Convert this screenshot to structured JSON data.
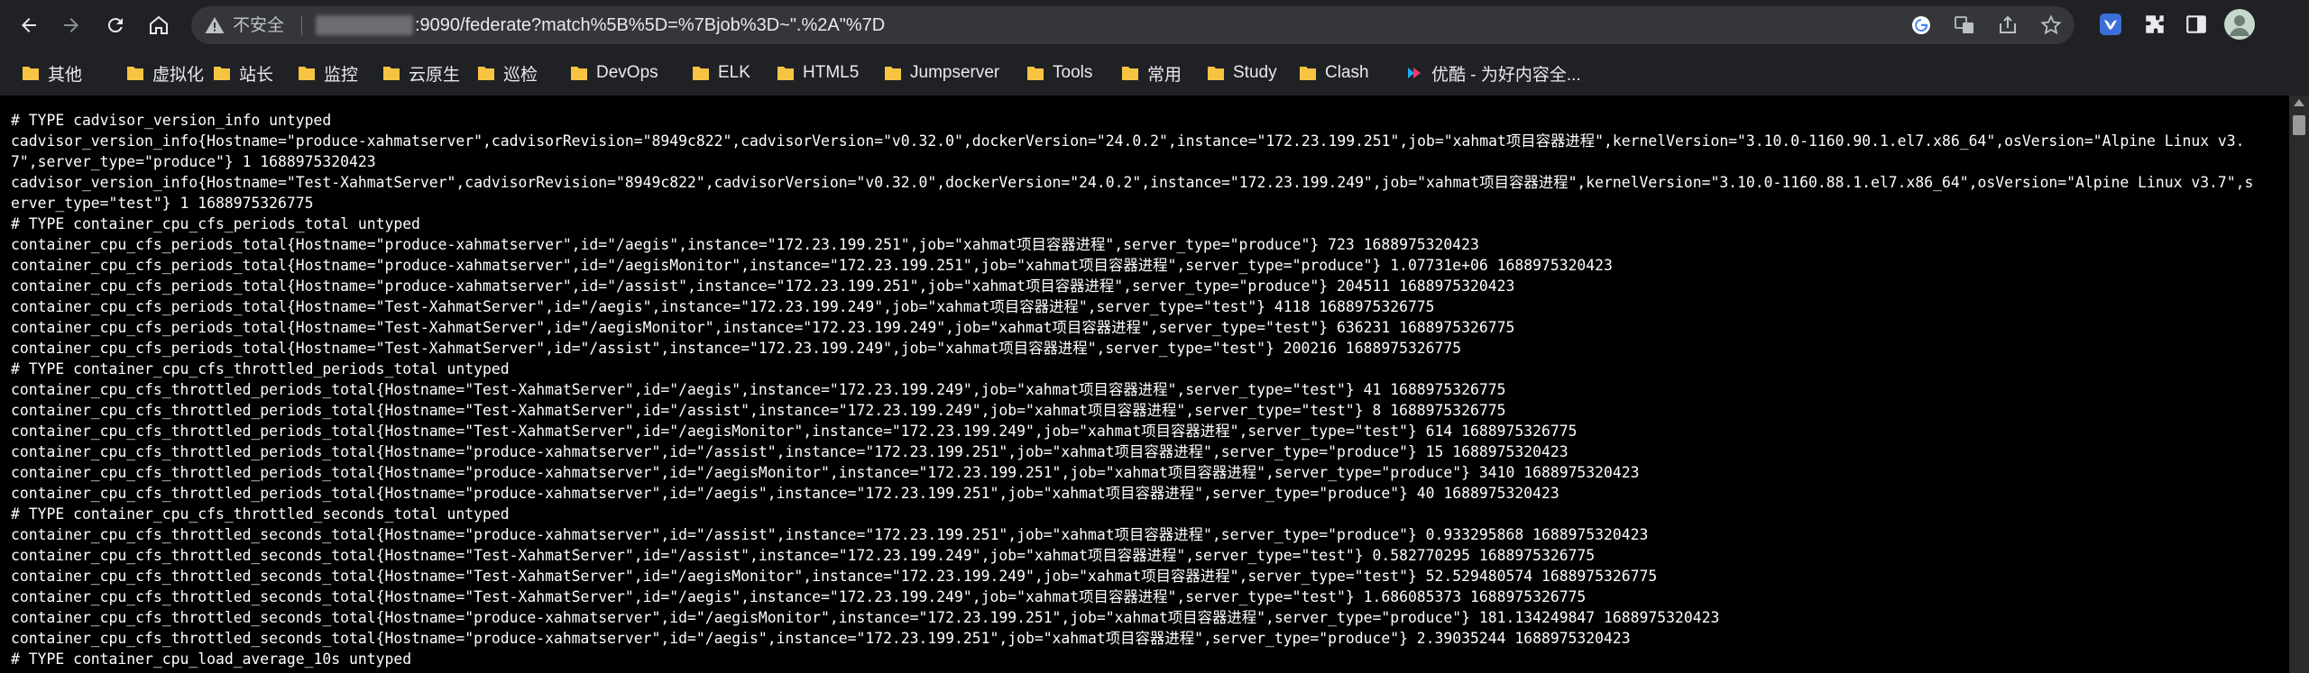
{
  "browser": {
    "security_label": "不安全",
    "url_visible": ":9090/federate?match%5B%5D=%7Bjob%3D~\".%2A\"%7D",
    "icons": [
      "back-arrow-icon",
      "forward-arrow-icon",
      "reload-icon",
      "home-icon",
      "warning-icon",
      "google-icon",
      "translate-icon",
      "share-icon",
      "star-icon",
      "extension-bird-icon",
      "puzzle-icon",
      "sidepanel-icon",
      "avatar"
    ]
  },
  "bookmarks": [
    {
      "label": "其他"
    },
    {
      "label": "虚拟化"
    },
    {
      "label": "站长"
    },
    {
      "label": "监控"
    },
    {
      "label": "云原生"
    },
    {
      "label": "巡检"
    },
    {
      "label": "DevOps"
    },
    {
      "label": "ELK"
    },
    {
      "label": "HTML5"
    },
    {
      "label": "Jumpserver"
    },
    {
      "label": "Tools"
    },
    {
      "label": "常用"
    },
    {
      "label": "Study"
    },
    {
      "label": "Clash"
    },
    {
      "label": "优酷 - 为好内容全..."
    }
  ],
  "colors": {
    "chrome_bg": "#202124",
    "omnibox_bg": "#35363a",
    "folder": "#f6c343",
    "page_bg": "#000000",
    "page_text": "#ffffff"
  },
  "lines": [
    "# TYPE cadvisor_version_info untyped",
    "cadvisor_version_info{Hostname=\"produce-xahmatserver\",cadvisorRevision=\"8949c822\",cadvisorVersion=\"v0.32.0\",dockerVersion=\"24.0.2\",instance=\"172.23.199.251\",job=\"xahmat项目容器进程\",kernelVersion=\"3.10.0-1160.90.1.el7.x86_64\",osVersion=\"Alpine Linux v3.7\",server_type=\"produce\"} 1 1688975320423",
    "cadvisor_version_info{Hostname=\"Test-XahmatServer\",cadvisorRevision=\"8949c822\",cadvisorVersion=\"v0.32.0\",dockerVersion=\"24.0.2\",instance=\"172.23.199.249\",job=\"xahmat项目容器进程\",kernelVersion=\"3.10.0-1160.88.1.el7.x86_64\",osVersion=\"Alpine Linux v3.7\",server_type=\"test\"} 1 1688975326775",
    "# TYPE container_cpu_cfs_periods_total untyped",
    "container_cpu_cfs_periods_total{Hostname=\"produce-xahmatserver\",id=\"/aegis\",instance=\"172.23.199.251\",job=\"xahmat项目容器进程\",server_type=\"produce\"} 723 1688975320423",
    "container_cpu_cfs_periods_total{Hostname=\"produce-xahmatserver\",id=\"/aegisMonitor\",instance=\"172.23.199.251\",job=\"xahmat项目容器进程\",server_type=\"produce\"} 1.07731e+06 1688975320423",
    "container_cpu_cfs_periods_total{Hostname=\"produce-xahmatserver\",id=\"/assist\",instance=\"172.23.199.251\",job=\"xahmat项目容器进程\",server_type=\"produce\"} 204511 1688975320423",
    "container_cpu_cfs_periods_total{Hostname=\"Test-XahmatServer\",id=\"/aegis\",instance=\"172.23.199.249\",job=\"xahmat项目容器进程\",server_type=\"test\"} 4118 1688975326775",
    "container_cpu_cfs_periods_total{Hostname=\"Test-XahmatServer\",id=\"/aegisMonitor\",instance=\"172.23.199.249\",job=\"xahmat项目容器进程\",server_type=\"test\"} 636231 1688975326775",
    "container_cpu_cfs_periods_total{Hostname=\"Test-XahmatServer\",id=\"/assist\",instance=\"172.23.199.249\",job=\"xahmat项目容器进程\",server_type=\"test\"} 200216 1688975326775",
    "# TYPE container_cpu_cfs_throttled_periods_total untyped",
    "container_cpu_cfs_throttled_periods_total{Hostname=\"Test-XahmatServer\",id=\"/aegis\",instance=\"172.23.199.249\",job=\"xahmat项目容器进程\",server_type=\"test\"} 41 1688975326775",
    "container_cpu_cfs_throttled_periods_total{Hostname=\"Test-XahmatServer\",id=\"/assist\",instance=\"172.23.199.249\",job=\"xahmat项目容器进程\",server_type=\"test\"} 8 1688975326775",
    "container_cpu_cfs_throttled_periods_total{Hostname=\"Test-XahmatServer\",id=\"/aegisMonitor\",instance=\"172.23.199.249\",job=\"xahmat项目容器进程\",server_type=\"test\"} 614 1688975326775",
    "container_cpu_cfs_throttled_periods_total{Hostname=\"produce-xahmatserver\",id=\"/assist\",instance=\"172.23.199.251\",job=\"xahmat项目容器进程\",server_type=\"produce\"} 15 1688975320423",
    "container_cpu_cfs_throttled_periods_total{Hostname=\"produce-xahmatserver\",id=\"/aegisMonitor\",instance=\"172.23.199.251\",job=\"xahmat项目容器进程\",server_type=\"produce\"} 3410 1688975320423",
    "container_cpu_cfs_throttled_periods_total{Hostname=\"produce-xahmatserver\",id=\"/aegis\",instance=\"172.23.199.251\",job=\"xahmat项目容器进程\",server_type=\"produce\"} 40 1688975320423",
    "# TYPE container_cpu_cfs_throttled_seconds_total untyped",
    "container_cpu_cfs_throttled_seconds_total{Hostname=\"produce-xahmatserver\",id=\"/assist\",instance=\"172.23.199.251\",job=\"xahmat项目容器进程\",server_type=\"produce\"} 0.933295868 1688975320423",
    "container_cpu_cfs_throttled_seconds_total{Hostname=\"Test-XahmatServer\",id=\"/assist\",instance=\"172.23.199.249\",job=\"xahmat项目容器进程\",server_type=\"test\"} 0.582770295 1688975326775",
    "container_cpu_cfs_throttled_seconds_total{Hostname=\"Test-XahmatServer\",id=\"/aegisMonitor\",instance=\"172.23.199.249\",job=\"xahmat项目容器进程\",server_type=\"test\"} 52.529480574 1688975326775",
    "container_cpu_cfs_throttled_seconds_total{Hostname=\"Test-XahmatServer\",id=\"/aegis\",instance=\"172.23.199.249\",job=\"xahmat项目容器进程\",server_type=\"test\"} 1.686085373 1688975326775",
    "container_cpu_cfs_throttled_seconds_total{Hostname=\"produce-xahmatserver\",id=\"/aegisMonitor\",instance=\"172.23.199.251\",job=\"xahmat项目容器进程\",server_type=\"produce\"} 181.134249847 1688975320423",
    "container_cpu_cfs_throttled_seconds_total{Hostname=\"produce-xahmatserver\",id=\"/aegis\",instance=\"172.23.199.251\",job=\"xahmat项目容器进程\",server_type=\"produce\"} 2.39035244 1688975320423",
    "# TYPE container_cpu_load_average_10s untyped"
  ]
}
